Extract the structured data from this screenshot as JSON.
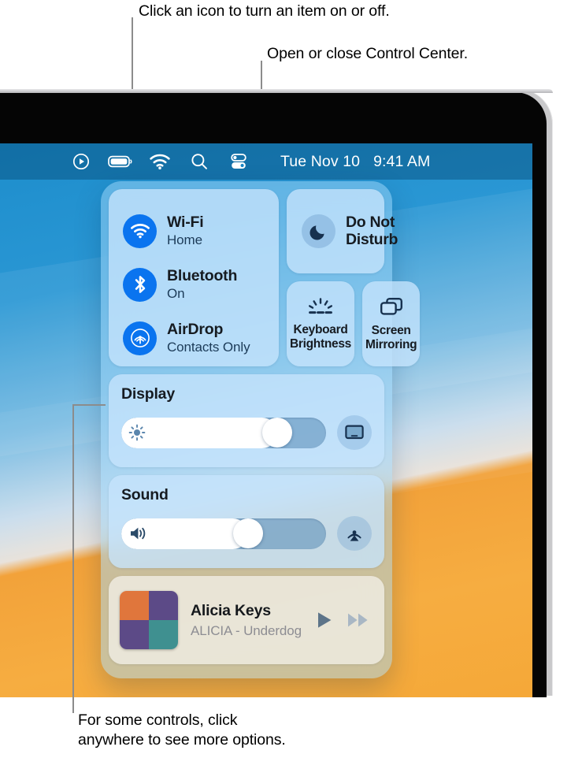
{
  "callouts": {
    "top": "Click an icon to turn an item on or off.",
    "middle": "Open or close Control Center.",
    "bottom": "For some controls, click\nanywhere to see more options."
  },
  "menubar": {
    "icons": [
      {
        "name": "now-playing-icon",
        "label": "Now Playing"
      },
      {
        "name": "battery-icon",
        "label": "Battery"
      },
      {
        "name": "wifi-icon",
        "label": "Wi-Fi"
      },
      {
        "name": "search-icon",
        "label": "Spotlight Search"
      },
      {
        "name": "control-center-icon",
        "label": "Control Center"
      }
    ],
    "date": "Tue Nov 10",
    "time": "9:41 AM"
  },
  "control_center": {
    "toggles": [
      {
        "title": "Wi-Fi",
        "status": "Home",
        "icon": "wifi-icon",
        "active": true
      },
      {
        "title": "Bluetooth",
        "status": "On",
        "icon": "bluetooth-icon",
        "active": true
      },
      {
        "title": "AirDrop",
        "status": "Contacts Only",
        "icon": "airdrop-icon",
        "active": true
      }
    ],
    "do_not_disturb": {
      "label": "Do Not\nDisturb",
      "icon": "moon-icon",
      "active": false
    },
    "tiles": [
      {
        "label": "Keyboard\nBrightness",
        "icon": "keyboard-brightness-icon"
      },
      {
        "label": "Screen\nMirroring",
        "icon": "screen-mirroring-icon"
      }
    ],
    "display": {
      "title": "Display",
      "icon": "brightness-icon",
      "value": 76,
      "action_icon": "display-icon"
    },
    "sound": {
      "title": "Sound",
      "icon": "volume-icon",
      "value": 62,
      "action_icon": "airplay-audio-icon"
    },
    "now_playing": {
      "artist": "Alicia Keys",
      "track": "ALICIA - Underdog",
      "album_art_colors": [
        "#e0763c",
        "#5c4a87",
        "#5c4a87",
        "#3f9090"
      ],
      "controls": [
        {
          "name": "play-button",
          "icon": "play-icon"
        },
        {
          "name": "fast-forward-button",
          "icon": "fast-forward-icon"
        }
      ]
    }
  },
  "colors": {
    "accent_blue": "#0a74ef",
    "panel_blue": "#a0d5f8",
    "card_blue": "#c6e4fc",
    "wallpaper_orange": "#f5a838",
    "wallpaper_blue": "#1b8ccb",
    "text_dark": "#161b21",
    "text_muted": "#1c3b58"
  }
}
